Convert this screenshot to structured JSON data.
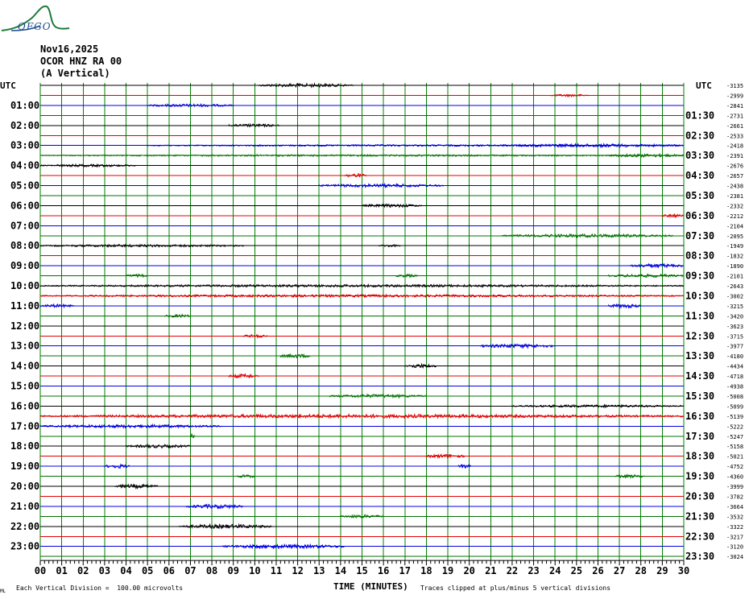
{
  "logo": {
    "name": "seismograph-wave-logo",
    "text": "OFGO"
  },
  "header": {
    "date": "Nov16,2025",
    "station": "OCOR HNZ RA 00",
    "component": "(A Vertical)"
  },
  "colors": {
    "black": "#000000",
    "red": "#e00000",
    "blue": "#0000e0",
    "green": "#007000",
    "grid": "#008000"
  },
  "chart_data": {
    "type": "helicorder",
    "left_axis_title": "UTC",
    "right_axis_title": "UTC",
    "left_labels": [
      "01:00",
      "02:00",
      "03:00",
      "04:00",
      "05:00",
      "06:00",
      "07:00",
      "08:00",
      "09:00",
      "10:00",
      "11:00",
      "12:00",
      "13:00",
      "14:00",
      "15:00",
      "16:00",
      "17:00",
      "18:00",
      "19:00",
      "20:00",
      "21:00",
      "22:00",
      "23:00"
    ],
    "right_labels": [
      "01:30",
      "02:30",
      "03:30",
      "04:30",
      "05:30",
      "06:30",
      "07:30",
      "08:30",
      "09:30",
      "10:30",
      "11:30",
      "12:30",
      "13:30",
      "14:30",
      "15:30",
      "16:30",
      "17:30",
      "18:30",
      "19:30",
      "20:30",
      "21:30",
      "22:30",
      "23:30"
    ],
    "trace_offsets": [
      "-3135",
      "-2999",
      "-2841",
      "-2731",
      "-2661",
      "-2533",
      "-2418",
      "-2391",
      "-2676",
      "-2657",
      "-2438",
      "-2381",
      "-2332",
      "-2212",
      "-2104",
      "-2095",
      "-1949",
      "-1832",
      "-1890",
      "-2101",
      "-2643",
      "-3002",
      "-3215",
      "-3420",
      "-3623",
      "-3715",
      "-3977",
      "-4180",
      "-4434",
      "-4718",
      "-4938",
      "-5008",
      "-5099",
      "-5139",
      "-5222",
      "-5247",
      "-5158",
      "-5021",
      "-4752",
      "-4360",
      "-3999",
      "-3782",
      "-3664",
      "-3532",
      "-3322",
      "-3217",
      "-3120",
      "-3024"
    ],
    "traces_per_hour": 2,
    "trace_colors": [
      "black",
      "red",
      "blue",
      "green"
    ],
    "x_ticks": [
      "00",
      "01",
      "02",
      "03",
      "04",
      "05",
      "06",
      "07",
      "08",
      "09",
      "10",
      "11",
      "12",
      "13",
      "14",
      "15",
      "16",
      "17",
      "18",
      "19",
      "20",
      "21",
      "22",
      "23",
      "24",
      "25",
      "26",
      "27",
      "28",
      "29",
      "30"
    ],
    "xlabel": "TIME (MINUTES)",
    "xlim": [
      0,
      30
    ],
    "grid": true,
    "activity": [
      {
        "trace": 0,
        "segments": [
          [
            10.2,
            14.6,
            2.2
          ]
        ]
      },
      {
        "trace": 1,
        "segments": [
          [
            23.8,
            25.6,
            1.5
          ]
        ]
      },
      {
        "trace": 2,
        "segments": [
          [
            5.0,
            9.0,
            1.8
          ]
        ]
      },
      {
        "trace": 4,
        "segments": [
          [
            8.8,
            11.2,
            1.8
          ]
        ]
      },
      {
        "trace": 6,
        "segments": [
          [
            5.0,
            30.0,
            1.0
          ],
          [
            21.5,
            30.0,
            2.0
          ]
        ]
      },
      {
        "trace": 7,
        "segments": [
          [
            0.0,
            30.0,
            1.0
          ],
          [
            26.5,
            30.0,
            2.0
          ]
        ]
      },
      {
        "trace": 8,
        "segments": [
          [
            0.0,
            4.5,
            1.5
          ]
        ]
      },
      {
        "trace": 9,
        "segments": [
          [
            14.2,
            15.2,
            2.5
          ]
        ]
      },
      {
        "trace": 10,
        "segments": [
          [
            13.0,
            18.8,
            2.0
          ]
        ]
      },
      {
        "trace": 12,
        "segments": [
          [
            15.0,
            17.8,
            2.0
          ]
        ]
      },
      {
        "trace": 13,
        "segments": [
          [
            29.0,
            30.0,
            2.0
          ]
        ]
      },
      {
        "trace": 15,
        "segments": [
          [
            21.5,
            29.5,
            2.0
          ]
        ]
      },
      {
        "trace": 16,
        "segments": [
          [
            0.0,
            9.5,
            1.5
          ],
          [
            15.8,
            16.8,
            1.5
          ]
        ]
      },
      {
        "trace": 18,
        "segments": [
          [
            27.5,
            30.0,
            2.5
          ]
        ]
      },
      {
        "trace": 19,
        "segments": [
          [
            4.0,
            5.0,
            2.0
          ],
          [
            16.6,
            17.6,
            1.8
          ],
          [
            26.5,
            30.0,
            2.0
          ]
        ]
      },
      {
        "trace": 20,
        "segments": [
          [
            0.0,
            30.0,
            1.5
          ]
        ]
      },
      {
        "trace": 21,
        "segments": [
          [
            0.0,
            30.0,
            1.5
          ]
        ]
      },
      {
        "trace": 22,
        "segments": [
          [
            0.0,
            1.6,
            2.0
          ],
          [
            26.5,
            28.0,
            2.5
          ]
        ]
      },
      {
        "trace": 23,
        "segments": [
          [
            5.8,
            7.0,
            2.0
          ]
        ]
      },
      {
        "trace": 25,
        "segments": [
          [
            9.5,
            10.6,
            2.0
          ]
        ]
      },
      {
        "trace": 26,
        "segments": [
          [
            20.5,
            24.0,
            2.5
          ]
        ]
      },
      {
        "trace": 27,
        "segments": [
          [
            11.2,
            12.6,
            2.5
          ]
        ]
      },
      {
        "trace": 28,
        "segments": [
          [
            17.0,
            18.5,
            2.5
          ]
        ]
      },
      {
        "trace": 29,
        "segments": [
          [
            8.8,
            10.2,
            2.5
          ]
        ]
      },
      {
        "trace": 31,
        "segments": [
          [
            13.5,
            18.0,
            2.0
          ]
        ]
      },
      {
        "trace": 32,
        "segments": [
          [
            22.0,
            30.0,
            1.5
          ]
        ]
      },
      {
        "trace": 33,
        "segments": [
          [
            0.0,
            30.0,
            2.2
          ]
        ]
      },
      {
        "trace": 34,
        "segments": [
          [
            0.0,
            8.5,
            2.0
          ]
        ]
      },
      {
        "trace": 35,
        "segments": [
          [
            7.0,
            7.2,
            4.0
          ]
        ]
      },
      {
        "trace": 36,
        "segments": [
          [
            4.0,
            7.0,
            2.0
          ]
        ]
      },
      {
        "trace": 37,
        "segments": [
          [
            18.0,
            19.8,
            2.5
          ]
        ]
      },
      {
        "trace": 38,
        "segments": [
          [
            3.0,
            4.2,
            2.5
          ],
          [
            19.5,
            20.1,
            2.5
          ]
        ]
      },
      {
        "trace": 39,
        "segments": [
          [
            9.2,
            10.0,
            2.0
          ],
          [
            26.8,
            28.2,
            2.0
          ]
        ]
      },
      {
        "trace": 40,
        "segments": [
          [
            3.5,
            5.5,
            2.5
          ]
        ]
      },
      {
        "trace": 42,
        "segments": [
          [
            6.8,
            9.5,
            2.5
          ]
        ]
      },
      {
        "trace": 43,
        "segments": [
          [
            14.0,
            16.0,
            2.0
          ]
        ]
      },
      {
        "trace": 44,
        "segments": [
          [
            6.5,
            10.8,
            2.5
          ]
        ]
      },
      {
        "trace": 46,
        "segments": [
          [
            8.5,
            14.2,
            2.5
          ]
        ]
      }
    ]
  },
  "footer": {
    "scale_note": "Each Vertical Division =  100.00 microvolts",
    "clip_note": "Traces clipped at plus/minus 5 vertical divisions",
    "corner_mark": "ML"
  }
}
